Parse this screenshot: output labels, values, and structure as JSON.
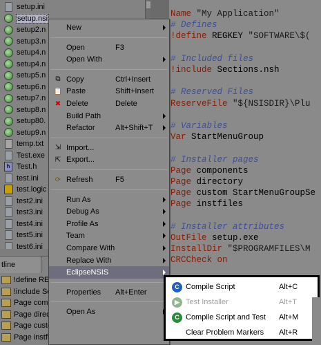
{
  "explorer": {
    "items": [
      {
        "label": "setup.ini",
        "icon": "ini-file-icon"
      },
      {
        "label": "setup.nsi",
        "icon": "nsi-file-icon",
        "selected": true
      },
      {
        "label": "setup2.n",
        "icon": "nsi-file-icon"
      },
      {
        "label": "setup3.n",
        "icon": "nsi-file-icon"
      },
      {
        "label": "setup4.n",
        "icon": "nsi-file-icon"
      },
      {
        "label": "setup4.n",
        "icon": "nsi-file-icon"
      },
      {
        "label": "setup5.n",
        "icon": "nsi-file-icon"
      },
      {
        "label": "setup6.n",
        "icon": "nsi-file-icon"
      },
      {
        "label": "setup7.n",
        "icon": "nsi-file-icon"
      },
      {
        "label": "setup8.n",
        "icon": "nsi-file-icon"
      },
      {
        "label": "setup80.",
        "icon": "nsi-file-icon"
      },
      {
        "label": "setup9.n",
        "icon": "nsi-file-icon"
      },
      {
        "label": "temp.txt",
        "icon": "text-file-icon"
      },
      {
        "label": "Test.exe",
        "icon": "exe-file-icon"
      },
      {
        "label": "Test.h",
        "icon": "header-file-icon"
      },
      {
        "label": "test.ini",
        "icon": "ini-file-icon"
      },
      {
        "label": "test.logic",
        "icon": "logic-file-icon"
      },
      {
        "label": "test2.ini",
        "icon": "ini-file-icon"
      },
      {
        "label": "test3.ini",
        "icon": "ini-file-icon"
      },
      {
        "label": "test4.ini",
        "icon": "ini-file-icon"
      },
      {
        "label": "test5.ini",
        "icon": "ini-file-icon"
      },
      {
        "label": "test6.ini",
        "icon": "ini-file-icon"
      }
    ]
  },
  "outline": {
    "tab_label": "tline",
    "items": [
      "!define REGK",
      "!include Sect",
      "Page compon",
      "Page directo",
      "Page custom StartMenuGroupSelect",
      "Page instfiles"
    ]
  },
  "editor": {
    "lines": [
      [
        {
          "t": "Name ",
          "c": "kw"
        },
        {
          "t": "\"My Application\"",
          "c": "str"
        }
      ],
      [
        {
          "t": "# Defines",
          "c": "cm"
        }
      ],
      [
        {
          "t": "!define ",
          "c": "def"
        },
        {
          "t": "REGKEY ",
          "c": "txt"
        },
        {
          "t": "\"SOFTWARE\\$(",
          "c": "str"
        }
      ],
      [
        {
          "t": "",
          "c": "txt"
        }
      ],
      [
        {
          "t": "# Included files",
          "c": "cm"
        }
      ],
      [
        {
          "t": "!include ",
          "c": "def"
        },
        {
          "t": "Sections.nsh",
          "c": "txt"
        }
      ],
      [
        {
          "t": "",
          "c": "txt"
        }
      ],
      [
        {
          "t": "# Reserved Files",
          "c": "cm"
        }
      ],
      [
        {
          "t": "ReserveFile ",
          "c": "kw"
        },
        {
          "t": "\"${NSISDIR}\\Plu",
          "c": "str"
        }
      ],
      [
        {
          "t": "",
          "c": "txt"
        }
      ],
      [
        {
          "t": "# Variables",
          "c": "cm"
        }
      ],
      [
        {
          "t": "Var ",
          "c": "kw"
        },
        {
          "t": "StartMenuGroup",
          "c": "txt"
        }
      ],
      [
        {
          "t": "",
          "c": "txt"
        }
      ],
      [
        {
          "t": "# Installer pages",
          "c": "cm"
        }
      ],
      [
        {
          "t": "Page ",
          "c": "kw"
        },
        {
          "t": "components",
          "c": "txt"
        }
      ],
      [
        {
          "t": "Page ",
          "c": "kw"
        },
        {
          "t": "directory",
          "c": "txt"
        }
      ],
      [
        {
          "t": "Page ",
          "c": "kw"
        },
        {
          "t": "custom StartMenuGroupSe",
          "c": "txt"
        }
      ],
      [
        {
          "t": "Page ",
          "c": "kw"
        },
        {
          "t": "instfiles",
          "c": "txt"
        }
      ],
      [
        {
          "t": "",
          "c": "txt"
        }
      ],
      [
        {
          "t": "# Installer attributes",
          "c": "cm"
        }
      ],
      [
        {
          "t": "OutFile ",
          "c": "kw"
        },
        {
          "t": "setup.exe",
          "c": "txt"
        }
      ],
      [
        {
          "t": "InstallDir ",
          "c": "kw"
        },
        {
          "t": "\"$PROGRAMFILES\\M",
          "c": "str"
        }
      ],
      [
        {
          "t": "CRCCheck on",
          "c": "kw"
        }
      ]
    ]
  },
  "context_menu": {
    "items": [
      {
        "label": "New",
        "mnemonic": "w",
        "submenu": true,
        "name": "menu-new"
      },
      {
        "sep": true
      },
      {
        "label": "Open",
        "shortcut": "F3",
        "name": "menu-open"
      },
      {
        "label": "Open With",
        "submenu": true,
        "name": "menu-open-with"
      },
      {
        "sep": true
      },
      {
        "label": "Copy",
        "shortcut": "Ctrl+Insert",
        "icon": "copy-icon",
        "name": "menu-copy"
      },
      {
        "label": "Paste",
        "shortcut": "Shift+Insert",
        "icon": "paste-icon",
        "name": "menu-paste"
      },
      {
        "label": "Delete",
        "shortcut": "Delete",
        "icon": "delete-icon",
        "name": "menu-delete"
      },
      {
        "label": "Build Path",
        "submenu": true,
        "name": "menu-build-path"
      },
      {
        "label": "Refactor",
        "shortcut": "Alt+Shift+T",
        "submenu": true,
        "name": "menu-refactor"
      },
      {
        "sep": true
      },
      {
        "label": "Import...",
        "icon": "import-icon",
        "name": "menu-import"
      },
      {
        "label": "Export...",
        "icon": "export-icon",
        "name": "menu-export"
      },
      {
        "sep": true
      },
      {
        "label": "Refresh",
        "shortcut": "F5",
        "icon": "refresh-icon",
        "name": "menu-refresh"
      },
      {
        "sep": true
      },
      {
        "label": "Run As",
        "submenu": true,
        "name": "menu-run-as"
      },
      {
        "label": "Debug As",
        "submenu": true,
        "name": "menu-debug-as"
      },
      {
        "label": "Profile As",
        "submenu": true,
        "name": "menu-profile-as"
      },
      {
        "label": "Team",
        "submenu": true,
        "name": "menu-team"
      },
      {
        "label": "Compare With",
        "submenu": true,
        "name": "menu-compare-with"
      },
      {
        "label": "Replace With",
        "submenu": true,
        "name": "menu-replace-with"
      },
      {
        "label": "EclipseNSIS",
        "submenu": true,
        "active": true,
        "name": "menu-eclipsensis"
      },
      {
        "sep": true
      },
      {
        "label": "Properties",
        "shortcut": "Alt+Enter",
        "name": "menu-properties"
      },
      {
        "sep": true
      },
      {
        "label": "Open As",
        "submenu": true,
        "name": "menu-open-as"
      }
    ]
  },
  "submenu": {
    "items": [
      {
        "label": "Compile Script",
        "shortcut": "Alt+C",
        "icon": "compile-icon",
        "color": "#2060c0",
        "glyph": "C"
      },
      {
        "label": "Test Installer",
        "shortcut": "Alt+T",
        "icon": "test-icon",
        "color": "#90b890",
        "glyph": "▶",
        "disabled": true
      },
      {
        "label": "Compile Script and Test",
        "shortcut": "Alt+M",
        "icon": "compile-test-icon",
        "color": "#2a8a3a",
        "glyph": "C"
      },
      {
        "label": "Clear Problem Markers",
        "shortcut": "Alt+R",
        "icon": "",
        "color": "",
        "glyph": ""
      }
    ]
  },
  "colors": {
    "menu_active": "#6d6d7d",
    "submenu_bg": "#ffffff"
  }
}
